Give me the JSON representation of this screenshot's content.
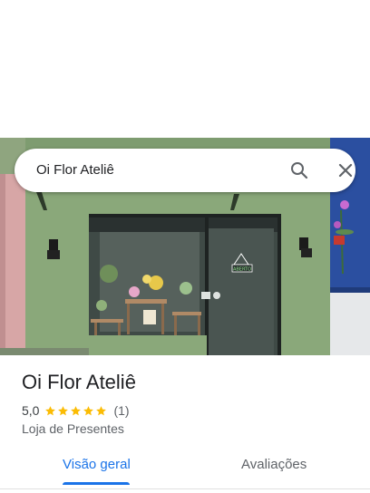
{
  "search": {
    "query": "Oi Flor Ateliê",
    "search_icon": "search-icon",
    "close_icon": "close-icon"
  },
  "photo": {
    "sign_text": "ABERTO"
  },
  "place": {
    "name": "Oi Flor Ateliê",
    "rating": "5,0",
    "stars": 5,
    "review_count": "(1)",
    "category": "Loja de Presentes"
  },
  "tabs": [
    {
      "label": "Visão geral",
      "active": true
    },
    {
      "label": "Avaliações",
      "active": false
    }
  ],
  "colors": {
    "accent": "#1a73e8",
    "star": "#fbbc04",
    "wall": "#8aa87a"
  }
}
